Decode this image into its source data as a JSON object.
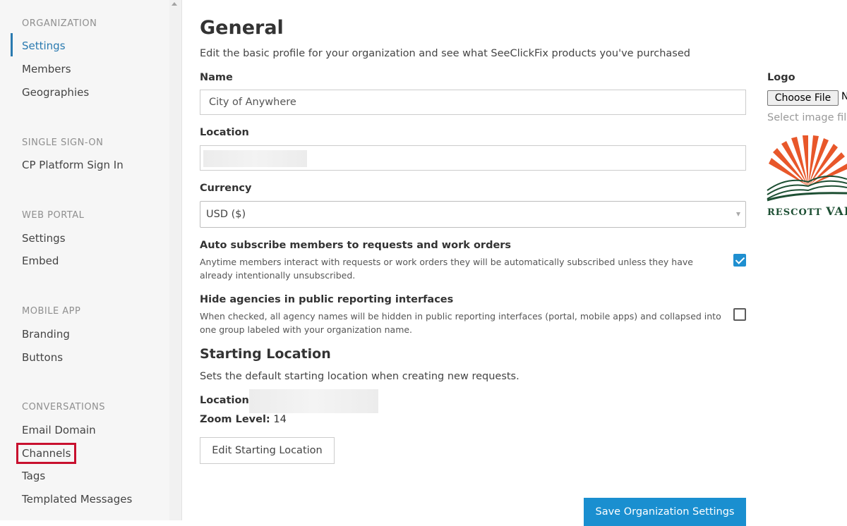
{
  "sidebar": {
    "sections": [
      {
        "title": "ORGANIZATION",
        "items": [
          "Settings",
          "Members",
          "Geographies"
        ]
      },
      {
        "title": "SINGLE SIGN-ON",
        "items": [
          "CP Platform Sign In"
        ]
      },
      {
        "title": "WEB PORTAL",
        "items": [
          "Settings",
          "Embed"
        ]
      },
      {
        "title": "MOBILE APP",
        "items": [
          "Branding",
          "Buttons"
        ]
      },
      {
        "title": "CONVERSATIONS",
        "items": [
          "Email Domain",
          "Channels",
          "Tags",
          "Templated Messages"
        ]
      }
    ],
    "active_item": "Settings",
    "highlighted_item": "Channels"
  },
  "main": {
    "title": "General",
    "subtitle": "Edit the basic profile for your organization and see what SeeClickFix products you've purchased",
    "name_label": "Name",
    "name_value": "City of Anywhere",
    "location_label": "Location",
    "currency_label": "Currency",
    "currency_value": "USD ($)",
    "auto_subscribe": {
      "title": "Auto subscribe members to requests and work orders",
      "desc": "Anytime members interact with requests or work orders they will be automatically subscribed unless they have already intentionally unsubscribed.",
      "checked": true
    },
    "hide_agencies": {
      "title": "Hide agencies in public reporting interfaces",
      "desc": "When checked, all agency names will be hidden in public reporting interfaces (portal, mobile apps) and collapsed into one group labeled with your organization name.",
      "checked": false
    },
    "starting_location": {
      "title": "Starting Location",
      "desc": "Sets the default starting location when creating new requests.",
      "location_label": "Location:",
      "zoom_label": "Zoom Level:",
      "zoom_value": "14",
      "edit_button": "Edit Starting Location"
    },
    "save_button": "Save Organization Settings"
  },
  "logo": {
    "label": "Logo",
    "choose_file": "Choose File",
    "file_status": "N",
    "hint": "Select image file",
    "logo_text_part1": "RESCOTT",
    "logo_text_part2": "VAL"
  },
  "colors": {
    "accent": "#2a7ab0",
    "primary_button": "#1a8fd0",
    "highlight_box": "#c8102e",
    "logo_orange": "#e8572a",
    "logo_green": "#1d4f33"
  }
}
